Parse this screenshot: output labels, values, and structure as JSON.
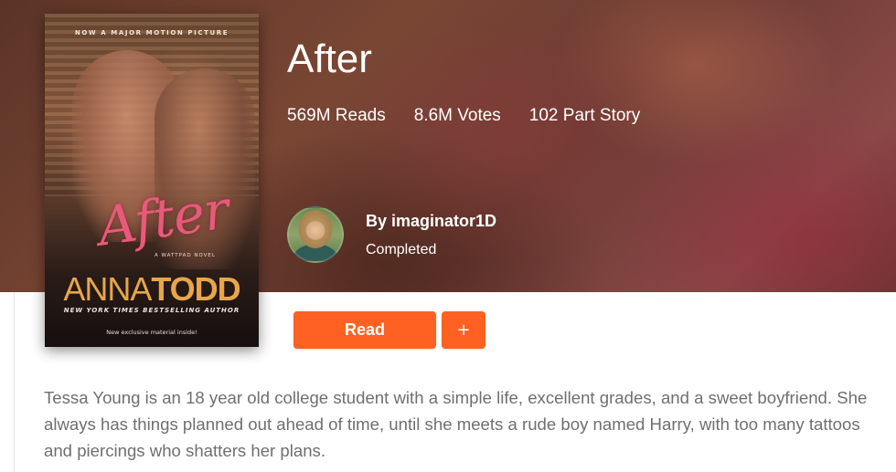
{
  "story": {
    "title": "After",
    "stats": {
      "reads": "569M Reads",
      "votes": "8.6M Votes",
      "parts": "102 Part Story"
    }
  },
  "cover": {
    "top_text": "NOW A MAJOR MOTION PICTURE",
    "title_script": "After",
    "novel_tag": "A WATTPAD NOVEL",
    "author_first": "ANNA",
    "author_last": "TODD",
    "tagline": "NEW YORK TIMES BESTSELLING AUTHOR",
    "note": "New exclusive material inside!"
  },
  "author": {
    "byline": "By imaginator1D",
    "status": "Completed",
    "avatar_icon": "user-avatar"
  },
  "actions": {
    "read_label": "Read",
    "add_label": "+"
  },
  "description": "Tessa Young is an 18 year old college student with a simple life, excellent grades, and a sweet boyfriend. She always has things planned out ahead of time, until she meets a rude boy named Harry, with too many tattoos and piercings who shatters her plans.",
  "colors": {
    "accent": "#ff6122",
    "description_text": "#6f6f6f",
    "hero_text": "#ffffff"
  }
}
